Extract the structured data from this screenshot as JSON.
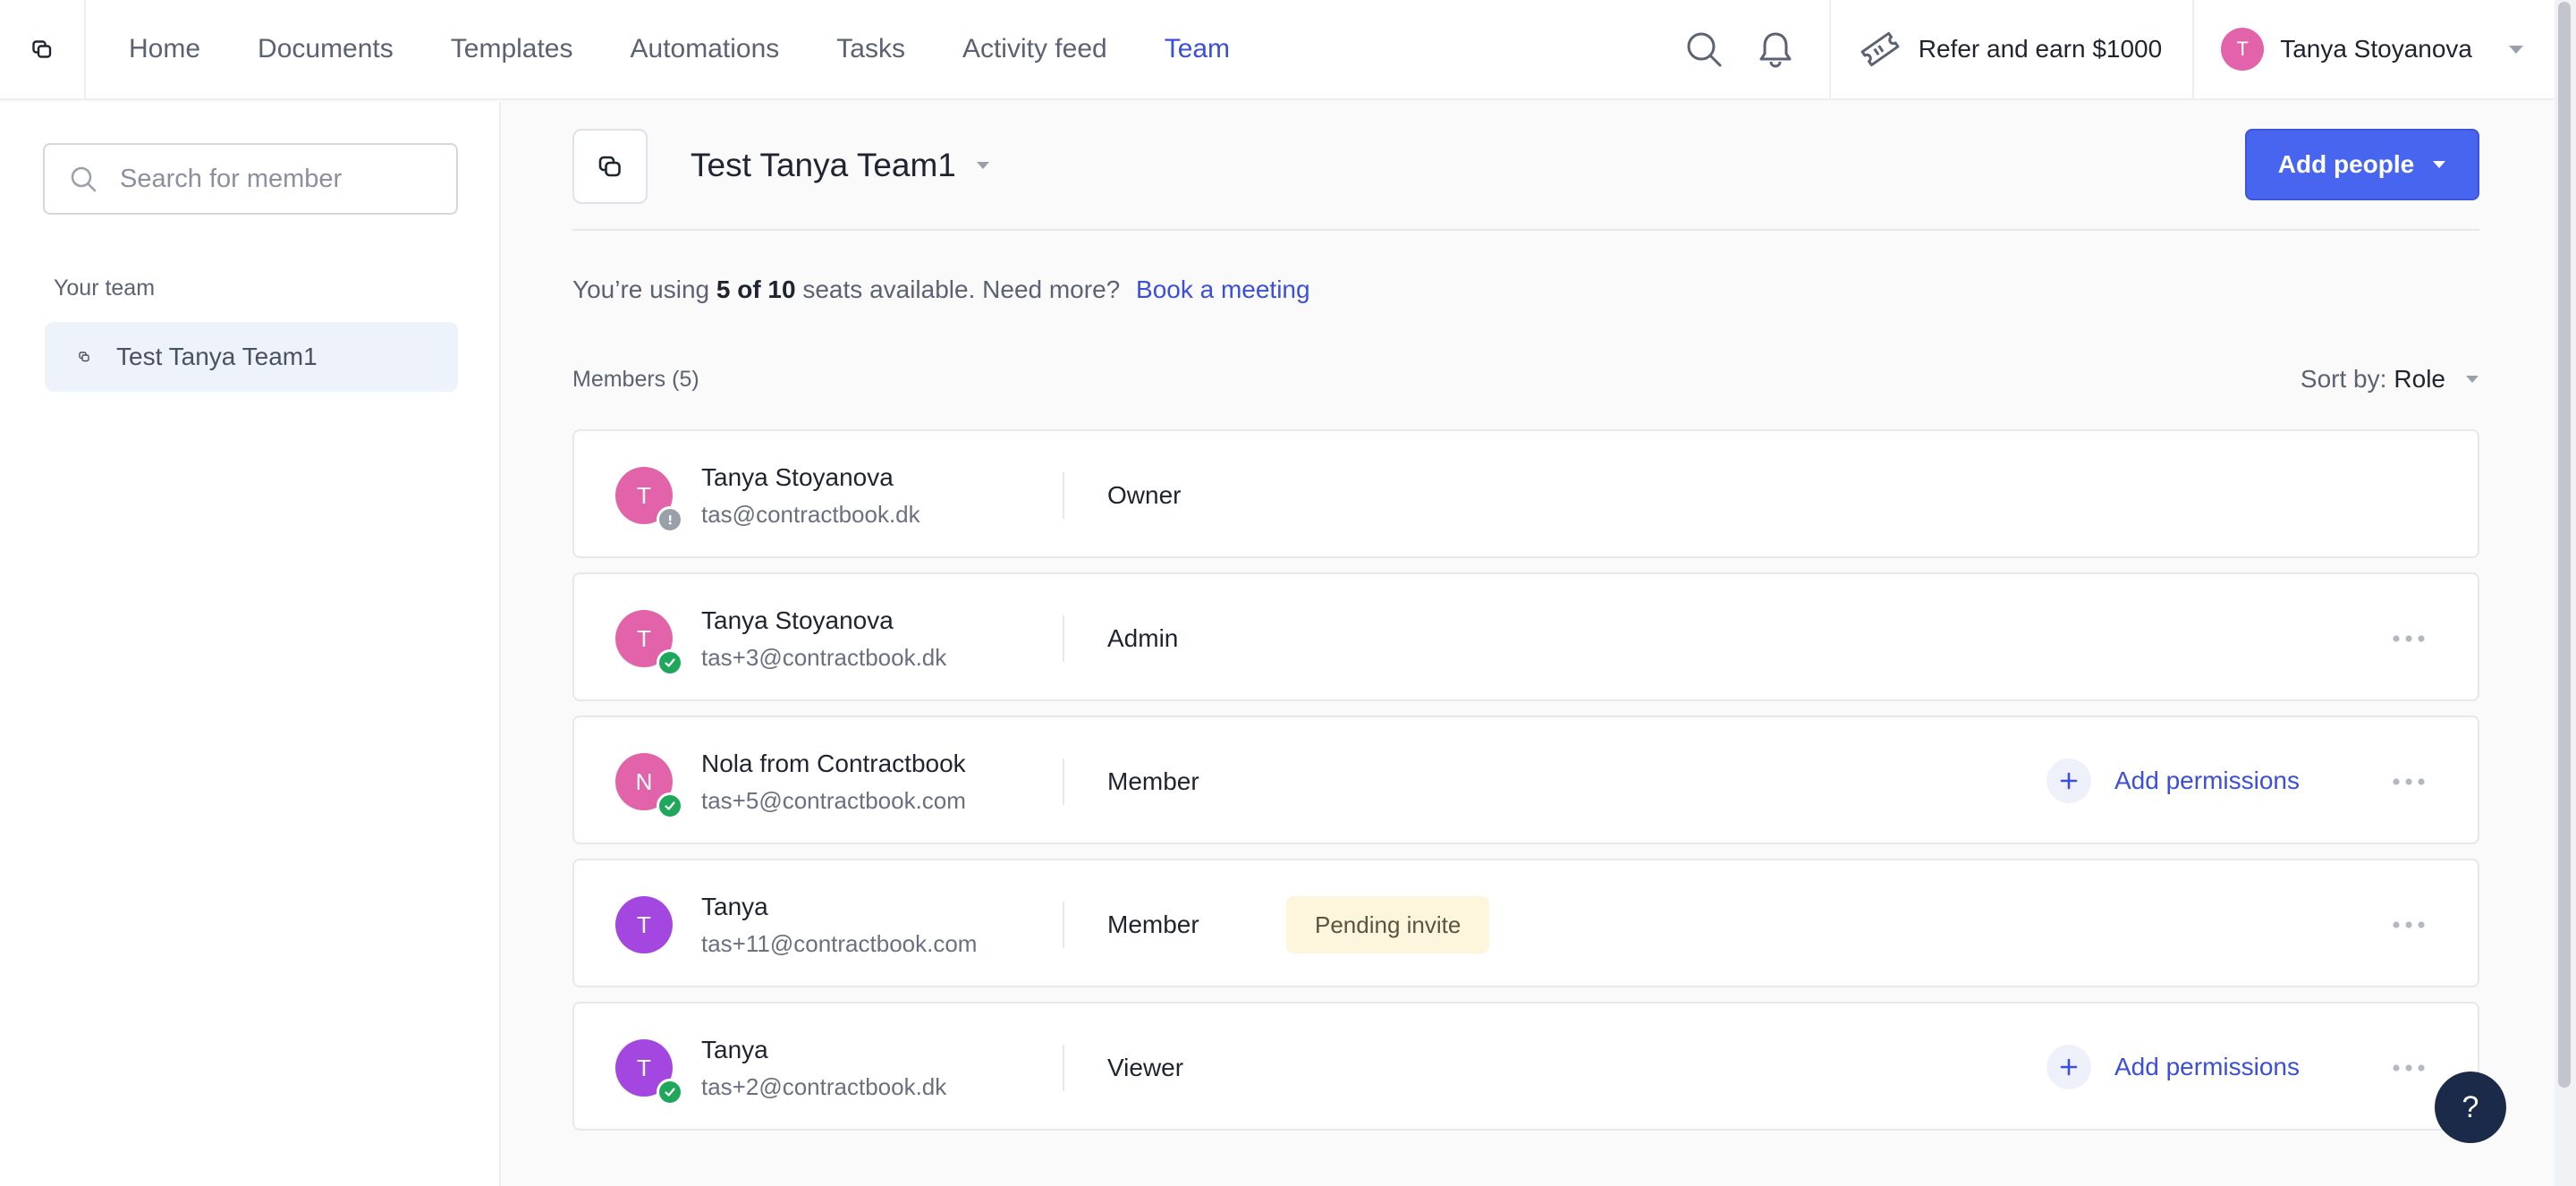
{
  "nav": {
    "items": [
      {
        "label": "Home"
      },
      {
        "label": "Documents"
      },
      {
        "label": "Templates"
      },
      {
        "label": "Automations"
      },
      {
        "label": "Tasks"
      },
      {
        "label": "Activity feed"
      },
      {
        "label": "Team"
      }
    ],
    "active": "Team",
    "refer_label": "Refer and earn $1000",
    "user_initial": "T",
    "user_name": "Tanya Stoyanova"
  },
  "sidebar": {
    "search_placeholder": "Search for member",
    "heading": "Your team",
    "team_label": "Test Tanya Team1"
  },
  "main": {
    "team_title": "Test Tanya Team1",
    "add_people_label": "Add people",
    "seats_prefix": "You’re using",
    "seats_used": "5 of 10",
    "seats_suffix": "seats available. Need more?",
    "book_meeting_label": "Book a meeting",
    "members_count_label": "Members (5)",
    "sort_label": "Sort by:",
    "sort_value": "Role"
  },
  "members": [
    {
      "initial": "T",
      "name": "Tanya Stoyanova",
      "email": "tas@contractbook.dk",
      "role": "Owner",
      "status": "warning",
      "pending": "",
      "add_permissions": "",
      "more": false
    },
    {
      "initial": "T",
      "name": "Tanya Stoyanova",
      "email": "tas+3@contractbook.dk",
      "role": "Admin",
      "status": "verified",
      "pending": "",
      "add_permissions": "",
      "more": true
    },
    {
      "initial": "N",
      "name": "Nola from Contractbook",
      "email": "tas+5@contractbook.com",
      "role": "Member",
      "status": "verified",
      "pending": "",
      "add_permissions": "Add permissions",
      "more": true
    },
    {
      "initial": "T",
      "name": "Tanya",
      "email": "tas+11@contractbook.com",
      "role": "Member",
      "status": "none",
      "pending": "Pending invite",
      "add_permissions": "",
      "more": true
    },
    {
      "initial": "T",
      "name": "Tanya",
      "email": "tas+2@contractbook.dk",
      "role": "Viewer",
      "status": "verified",
      "pending": "",
      "add_permissions": "Add permissions",
      "more": true
    }
  ],
  "help_label": "?",
  "colors": {
    "accent": "#3b4fd8",
    "primary_button": "#4865f0",
    "avatar_pink": "#e263a9",
    "avatar_purple": "#a347e0",
    "verified": "#1fa85b",
    "warning": "#9aa0aa",
    "pending_bg": "#fdf6dc"
  },
  "icons": {
    "logo": "contractbook-logo-icon",
    "search": "search-icon",
    "bell": "bell-icon",
    "ticket": "ticket-icon",
    "more": "more-horizontal-icon"
  }
}
